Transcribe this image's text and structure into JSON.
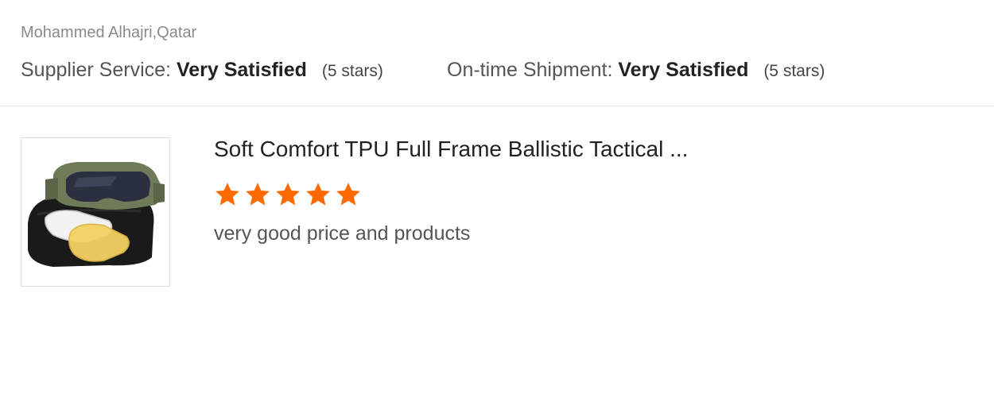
{
  "review": {
    "reviewer": "Mohammed Alhajri,Qatar",
    "ratings": [
      {
        "label": "Supplier Service:",
        "value": "Very Satisfied",
        "stars_note": "(5 stars)"
      },
      {
        "label": "On-time Shipment:",
        "value": "Very Satisfied",
        "stars_note": "(5 stars)"
      }
    ],
    "product": {
      "title": "Soft Comfort TPU Full Frame Ballistic Tactical ...",
      "image_icon": "tactical-goggles-image",
      "rating": 5,
      "rating_max": 5,
      "comment": "very good price and products"
    }
  },
  "colors": {
    "star": "#ff6a00",
    "divider": "#e3e3e3"
  }
}
